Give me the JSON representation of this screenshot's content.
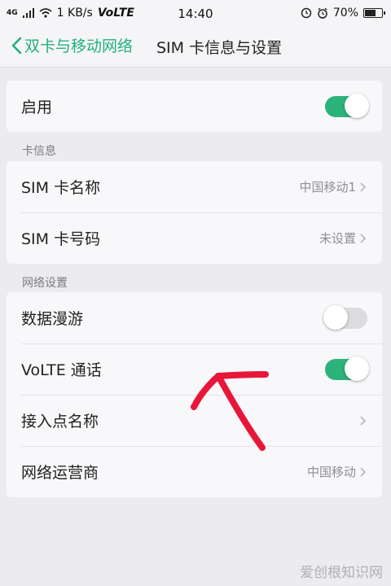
{
  "status_bar": {
    "network_type": "4G",
    "speed": "1 KB/s",
    "volte": "VoLTE",
    "time": "14:40",
    "battery": "70%",
    "battery_level": 0.7
  },
  "nav": {
    "back_label": "双卡与移动网络",
    "title": "SIM 卡信息与设置"
  },
  "enable": {
    "label": "启用",
    "on": true
  },
  "card_info": {
    "header": "卡信息",
    "items": [
      {
        "label": "SIM 卡名称",
        "value": "中国移动1"
      },
      {
        "label": "SIM 卡号码",
        "value": "未设置"
      }
    ]
  },
  "network": {
    "header": "网络设置",
    "roaming": {
      "label": "数据漫游",
      "on": false
    },
    "volte_call": {
      "label": "VoLTE 通话",
      "on": true
    },
    "apn": {
      "label": "接入点名称"
    },
    "operator": {
      "label": "网络运营商",
      "value": "中国移动"
    }
  },
  "watermark": "爱创根知识网",
  "colors": {
    "accent": "#2cb37c",
    "annotation_arrow": "#e8173a"
  },
  "icons": [
    "signal-icon",
    "wifi-icon",
    "alarm-icon",
    "clock-icon",
    "battery-icon",
    "chevron-left-icon",
    "chevron-right-icon"
  ]
}
